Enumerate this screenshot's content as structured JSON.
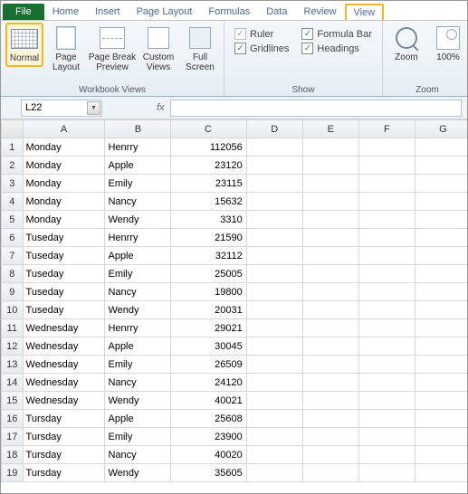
{
  "tabs": {
    "file": "File",
    "items": [
      "Home",
      "Insert",
      "Page Layout",
      "Formulas",
      "Data",
      "Review",
      "View"
    ],
    "active": "View"
  },
  "ribbon": {
    "workbook_views": {
      "title": "Workbook Views",
      "normal": "Normal",
      "page_layout": "Page\nLayout",
      "page_break": "Page Break\nPreview",
      "custom": "Custom\nViews",
      "full": "Full\nScreen"
    },
    "show": {
      "title": "Show",
      "ruler": "Ruler",
      "gridlines": "Gridlines",
      "formula_bar": "Formula Bar",
      "headings": "Headings"
    },
    "zoom": {
      "title": "Zoom",
      "zoom": "Zoom",
      "z100": "100%"
    }
  },
  "formula_bar": {
    "name_box": "L22",
    "fx": "fx"
  },
  "columns": [
    "A",
    "B",
    "C",
    "D",
    "E",
    "F",
    "G"
  ],
  "rows": [
    {
      "n": "1",
      "a": "Monday",
      "b": "Henrry",
      "c": "112056"
    },
    {
      "n": "2",
      "a": "Monday",
      "b": "Apple",
      "c": "23120"
    },
    {
      "n": "3",
      "a": "Monday",
      "b": "Emily",
      "c": "23115"
    },
    {
      "n": "4",
      "a": "Monday",
      "b": "Nancy",
      "c": "15632"
    },
    {
      "n": "5",
      "a": "Monday",
      "b": "Wendy",
      "c": "3310",
      "dash": true
    },
    {
      "n": "6",
      "a": "Tuseday",
      "b": "Henrry",
      "c": "21590"
    },
    {
      "n": "7",
      "a": "Tuseday",
      "b": "Apple",
      "c": "32112"
    },
    {
      "n": "8",
      "a": "Tuseday",
      "b": "Emily",
      "c": "25005"
    },
    {
      "n": "9",
      "a": "Tuseday",
      "b": "Nancy",
      "c": "19800"
    },
    {
      "n": "10",
      "a": "Tuseday",
      "b": "Wendy",
      "c": "20031"
    },
    {
      "n": "11",
      "a": "Wednesday",
      "b": "Henrry",
      "c": "29021"
    },
    {
      "n": "12",
      "a": "Wednesday",
      "b": "Apple",
      "c": "30045"
    },
    {
      "n": "13",
      "a": "Wednesday",
      "b": "Emily",
      "c": "26509"
    },
    {
      "n": "14",
      "a": "Wednesday",
      "b": "Nancy",
      "c": "24120"
    },
    {
      "n": "15",
      "a": "Wednesday",
      "b": "Wendy",
      "c": "40021"
    },
    {
      "n": "16",
      "a": "Tursday",
      "b": "Apple",
      "c": "25608"
    },
    {
      "n": "17",
      "a": "Tursday",
      "b": "Emily",
      "c": "23900"
    },
    {
      "n": "18",
      "a": "Tursday",
      "b": "Nancy",
      "c": "40020"
    },
    {
      "n": "19",
      "a": "Tursday",
      "b": "Wendy",
      "c": "35605"
    }
  ]
}
